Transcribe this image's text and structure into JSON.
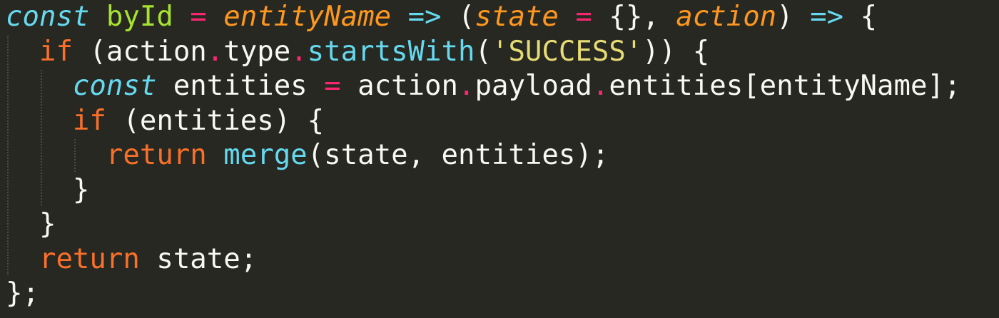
{
  "editor": {
    "theme_colors": {
      "background": "#272822",
      "plain": "#f8f8f2",
      "storage": "#66d9ef",
      "name": "#a6e22e",
      "operator": "#f92672",
      "parameter": "#fd971f",
      "string": "#e6db74",
      "keyword": "#f9702a"
    },
    "lines": [
      {
        "tokens": [
          {
            "t": "const",
            "c": "c-storage"
          },
          {
            "t": " ",
            "c": "c-plain"
          },
          {
            "t": "byId",
            "c": "c-name"
          },
          {
            "t": " ",
            "c": "c-plain"
          },
          {
            "t": "=",
            "c": "c-op"
          },
          {
            "t": " ",
            "c": "c-plain"
          },
          {
            "t": "entityName",
            "c": "c-param"
          },
          {
            "t": " ",
            "c": "c-plain"
          },
          {
            "t": "=>",
            "c": "c-arrow"
          },
          {
            "t": " (",
            "c": "c-plain"
          },
          {
            "t": "state",
            "c": "c-param"
          },
          {
            "t": " ",
            "c": "c-plain"
          },
          {
            "t": "=",
            "c": "c-op"
          },
          {
            "t": " {}, ",
            "c": "c-plain"
          },
          {
            "t": "action",
            "c": "c-param"
          },
          {
            "t": ") ",
            "c": "c-plain"
          },
          {
            "t": "=>",
            "c": "c-arrow"
          },
          {
            "t": " {",
            "c": "c-plain"
          }
        ]
      },
      {
        "tokens": [
          {
            "t": "  ",
            "c": "c-plain"
          },
          {
            "t": "if",
            "c": "c-keyword-red"
          },
          {
            "t": " (action",
            "c": "c-plain"
          },
          {
            "t": ".",
            "c": "c-dot"
          },
          {
            "t": "type",
            "c": "c-plain"
          },
          {
            "t": ".",
            "c": "c-dot"
          },
          {
            "t": "startsWith",
            "c": "c-func"
          },
          {
            "t": "(",
            "c": "c-plain"
          },
          {
            "t": "'SUCCESS'",
            "c": "c-string"
          },
          {
            "t": ")) {",
            "c": "c-plain"
          }
        ]
      },
      {
        "tokens": [
          {
            "t": "    ",
            "c": "c-plain"
          },
          {
            "t": "const",
            "c": "c-storage"
          },
          {
            "t": " entities ",
            "c": "c-plain"
          },
          {
            "t": "=",
            "c": "c-op"
          },
          {
            "t": " action",
            "c": "c-plain"
          },
          {
            "t": ".",
            "c": "c-dot"
          },
          {
            "t": "payload",
            "c": "c-plain"
          },
          {
            "t": ".",
            "c": "c-dot"
          },
          {
            "t": "entities[entityName];",
            "c": "c-plain"
          }
        ]
      },
      {
        "tokens": [
          {
            "t": "    ",
            "c": "c-plain"
          },
          {
            "t": "if",
            "c": "c-keyword-red"
          },
          {
            "t": " (entities) {",
            "c": "c-plain"
          }
        ]
      },
      {
        "tokens": [
          {
            "t": "      ",
            "c": "c-plain"
          },
          {
            "t": "return",
            "c": "c-keyword-red"
          },
          {
            "t": " ",
            "c": "c-plain"
          },
          {
            "t": "merge",
            "c": "c-func"
          },
          {
            "t": "(state, entities);",
            "c": "c-plain"
          }
        ]
      },
      {
        "tokens": [
          {
            "t": "    }",
            "c": "c-plain"
          }
        ]
      },
      {
        "tokens": [
          {
            "t": "  }",
            "c": "c-plain"
          }
        ]
      },
      {
        "tokens": [
          {
            "t": "  ",
            "c": "c-plain"
          },
          {
            "t": "return",
            "c": "c-keyword-red"
          },
          {
            "t": " state;",
            "c": "c-plain"
          }
        ]
      },
      {
        "tokens": [
          {
            "t": "};",
            "c": "c-plain"
          }
        ]
      }
    ]
  }
}
